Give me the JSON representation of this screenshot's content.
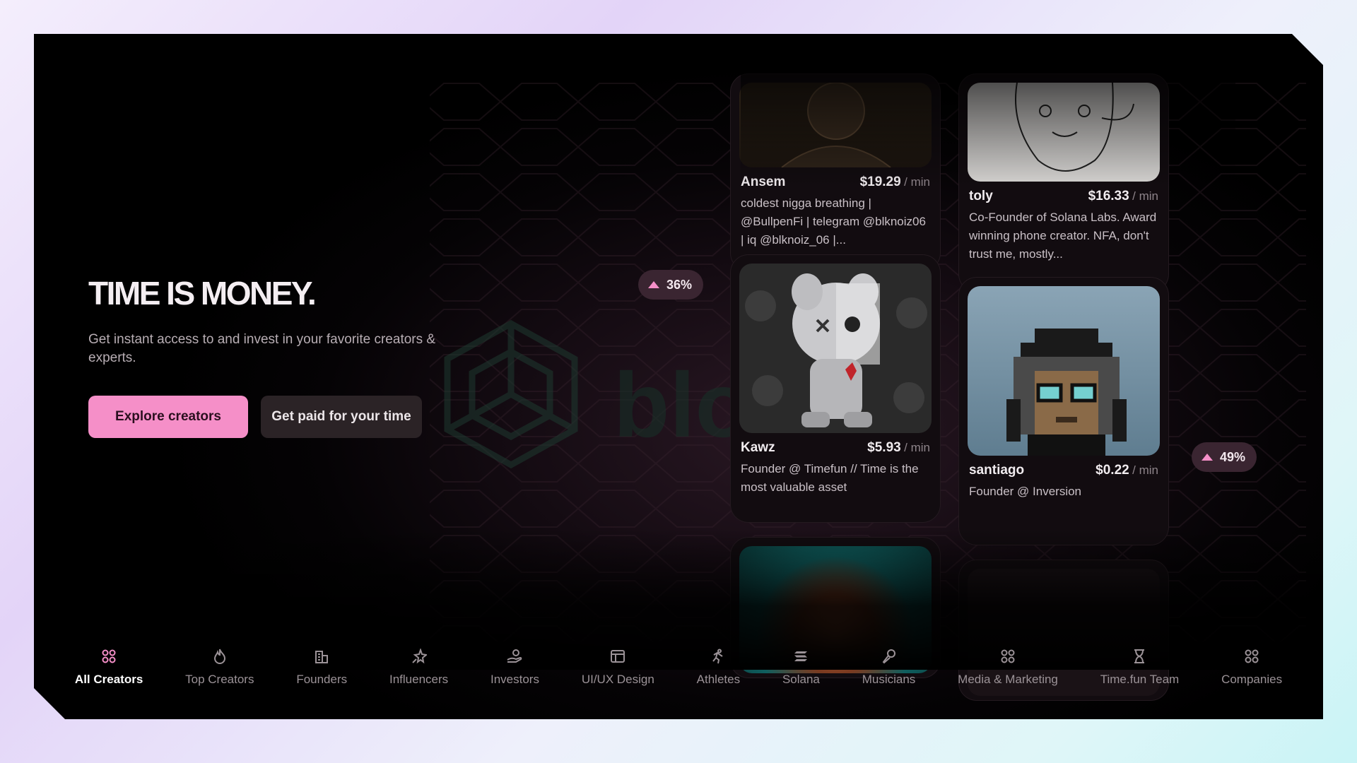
{
  "hero": {
    "title": "TIME IS MONEY.",
    "subtitle": "Get instant access to and invest in your favorite creators & experts.",
    "primary_cta": "Explore creators",
    "secondary_cta": "Get paid for your time"
  },
  "watermark": "blockd",
  "badges": [
    {
      "value": "36%",
      "direction": "up"
    },
    {
      "value": "49%",
      "direction": "up"
    }
  ],
  "cards": [
    {
      "name": "Ansem",
      "price": "$19.29",
      "unit": "/ min",
      "bio": "coldest nigga breathing | @BullpenFi | telegram @blknoiz06 | iq @blknoiz_06 |..."
    },
    {
      "name": "toly",
      "price": "$16.33",
      "unit": "/ min",
      "bio": "Co-Founder of Solana Labs. Award winning phone creator. NFA, don't trust me, mostly..."
    },
    {
      "name": "Kawz",
      "price": "$5.93",
      "unit": "/ min",
      "bio": "Founder @ Timefun // Time is the most valuable asset"
    },
    {
      "name": "santiago",
      "price": "$0.22",
      "unit": "/ min",
      "bio": "Founder @ Inversion"
    }
  ],
  "nav": {
    "items": [
      {
        "label": "All Creators",
        "icon": "grid-icon",
        "active": true
      },
      {
        "label": "Top Creators",
        "icon": "flame-icon"
      },
      {
        "label": "Founders",
        "icon": "building-icon"
      },
      {
        "label": "Influencers",
        "icon": "sparkle-icon"
      },
      {
        "label": "Investors",
        "icon": "hand-coin-icon"
      },
      {
        "label": "UI/UX Design",
        "icon": "layout-icon"
      },
      {
        "label": "Athletes",
        "icon": "runner-icon"
      },
      {
        "label": "Solana",
        "icon": "solana-icon"
      },
      {
        "label": "Musicians",
        "icon": "microphone-icon"
      },
      {
        "label": "Media & Marketing",
        "icon": "grid-icon"
      },
      {
        "label": "Time.fun Team",
        "icon": "hourglass-icon"
      },
      {
        "label": "Companies",
        "icon": "grid-icon"
      }
    ]
  },
  "colors": {
    "accent": "#f58fc8",
    "background": "#000000",
    "card": "#120c10"
  }
}
